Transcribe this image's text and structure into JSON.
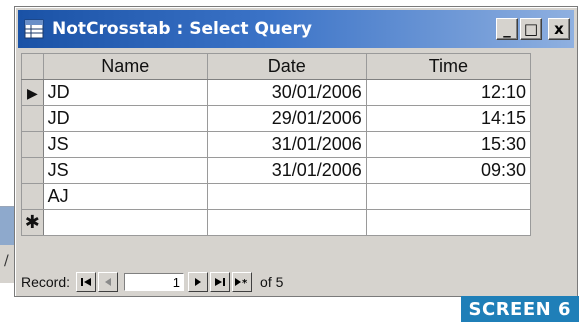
{
  "window": {
    "title": "NotCrosstab : Select Query",
    "buttons": {
      "minimize": "_",
      "maximize": "□",
      "close": "x"
    }
  },
  "datasheet": {
    "columns": [
      "Name",
      "Date",
      "Time"
    ],
    "rows": [
      {
        "selector": "current",
        "name": "JD",
        "date": "30/01/2006",
        "time": "12:10"
      },
      {
        "selector": "",
        "name": "JD",
        "date": "29/01/2006",
        "time": "14:15"
      },
      {
        "selector": "",
        "name": "JS",
        "date": "31/01/2006",
        "time": "15:30"
      },
      {
        "selector": "",
        "name": "JS",
        "date": "31/01/2006",
        "time": "09:30"
      },
      {
        "selector": "",
        "name": "AJ",
        "date": "",
        "time": ""
      },
      {
        "selector": "new",
        "name": "",
        "date": "",
        "time": ""
      }
    ],
    "selector_glyphs": {
      "current": "▶",
      "new": "✱"
    }
  },
  "navigator": {
    "label": "Record:",
    "current": "1",
    "total_label": "of 5"
  },
  "badge": "SCREEN 6",
  "colors": {
    "titlebar_start": "#1a52a6",
    "titlebar_end": "#8fb0e0",
    "window_bg": "#d6d3ce",
    "badge_bg": "#1f7fb8"
  }
}
